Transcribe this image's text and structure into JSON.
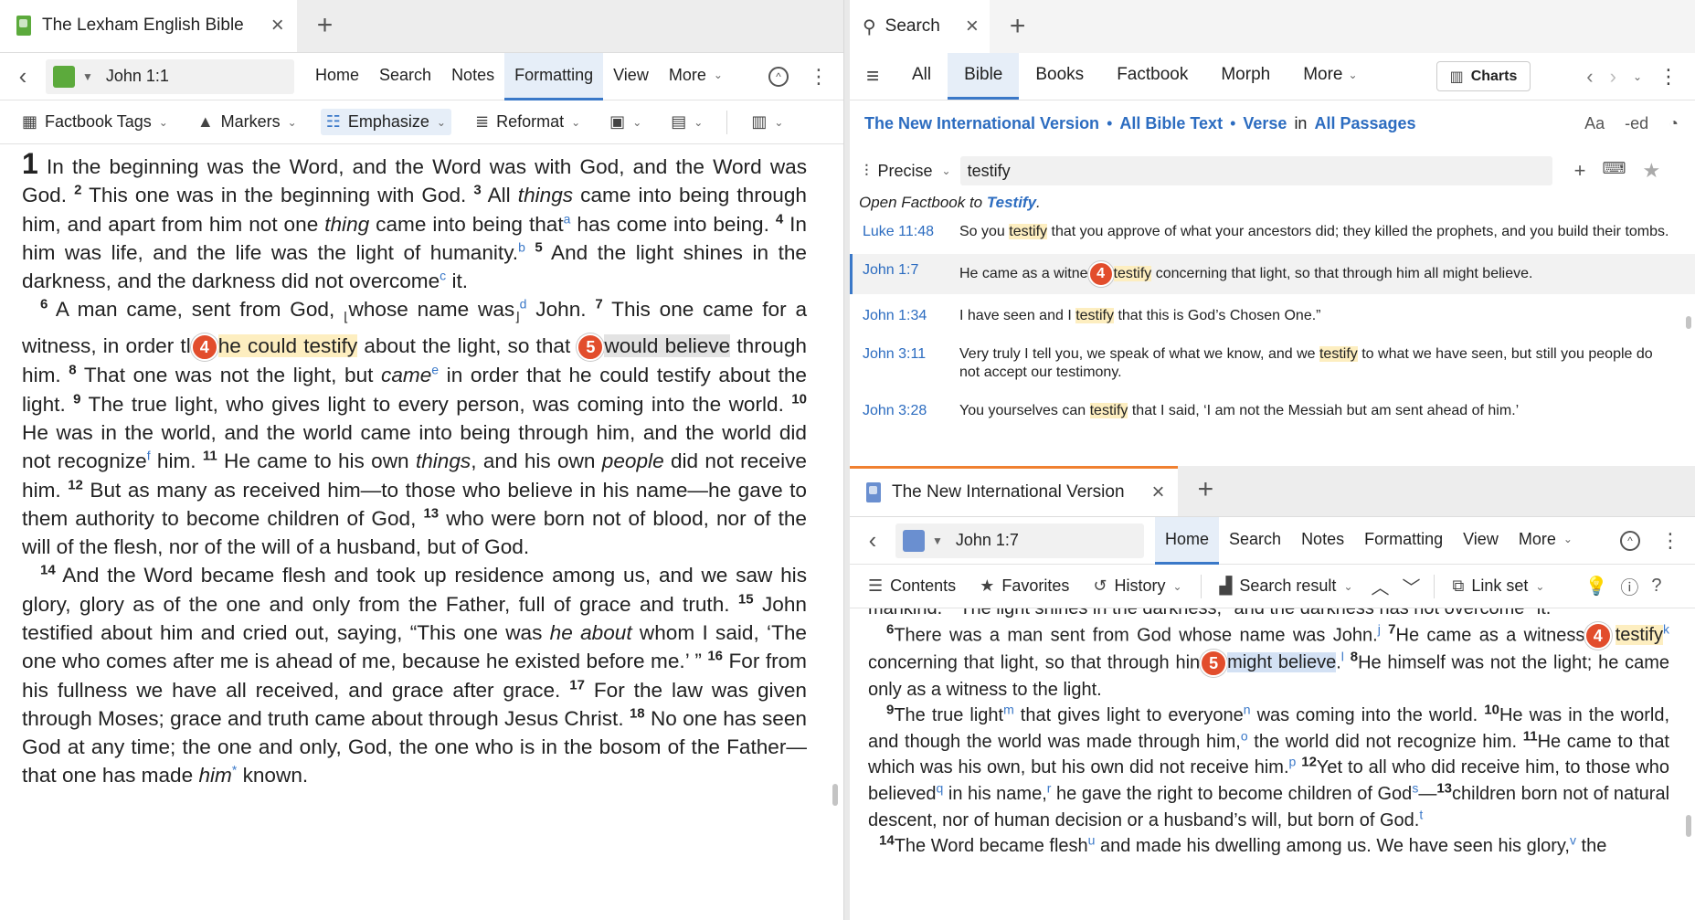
{
  "left": {
    "tab_title": "The Lexham English Bible",
    "reference": "John 1:1",
    "nav": [
      "Home",
      "Search",
      "Notes",
      "Formatting",
      "View",
      "More"
    ],
    "toolbar": [
      "Factbook Tags",
      "Markers",
      "Emphasize",
      "Reformat"
    ],
    "badge_a": "4",
    "badge_b": "5"
  },
  "search": {
    "tab_title": "Search",
    "categories": [
      "All",
      "Bible",
      "Books",
      "Factbook",
      "Morph",
      "More"
    ],
    "charts": "Charts",
    "scope": {
      "version": "The New International Version",
      "text": "All Bible Text",
      "unit": "Verse",
      "in": "in",
      "passages": "All Passages"
    },
    "mode": "Precise",
    "query": "testify",
    "factbook_prefix": "Open Factbook to ",
    "factbook_link": "Testify",
    "factbook_suffix": ".",
    "results": [
      {
        "ref": "Luke 11:48",
        "pre": "So you ",
        "hit": "testify",
        "post": " that you approve of what your ancestors did; they killed the prophets, and you build their tombs."
      },
      {
        "ref": "John 1:7",
        "pre": "He came as a witne",
        "badge": "4",
        "hit": "testify",
        "post": " concerning that light, so that through him all might believe."
      },
      {
        "ref": "John 1:34",
        "pre": "I have seen and I ",
        "hit": "testify",
        "post": " that this is God’s Chosen One.”"
      },
      {
        "ref": "John 3:11",
        "pre": "Very truly I tell you, we speak of what we know, and we ",
        "hit": "testify",
        "post": " to what we have seen, but still you people do not accept our testimony."
      },
      {
        "ref": "John 3:28",
        "pre": "You yourselves can ",
        "hit": "testify",
        "post": " that I said, ‘I am not the Messiah but am sent ahead of him.’"
      }
    ]
  },
  "niv": {
    "tab_title": "The New International Version",
    "reference": "John 1:7",
    "nav": [
      "Home",
      "Search",
      "Notes",
      "Formatting",
      "View",
      "More"
    ],
    "toolbar": [
      "Contents",
      "Favorites",
      "History",
      "Search result",
      "Link set"
    ],
    "badge_a": "4",
    "badge_b": "5"
  }
}
